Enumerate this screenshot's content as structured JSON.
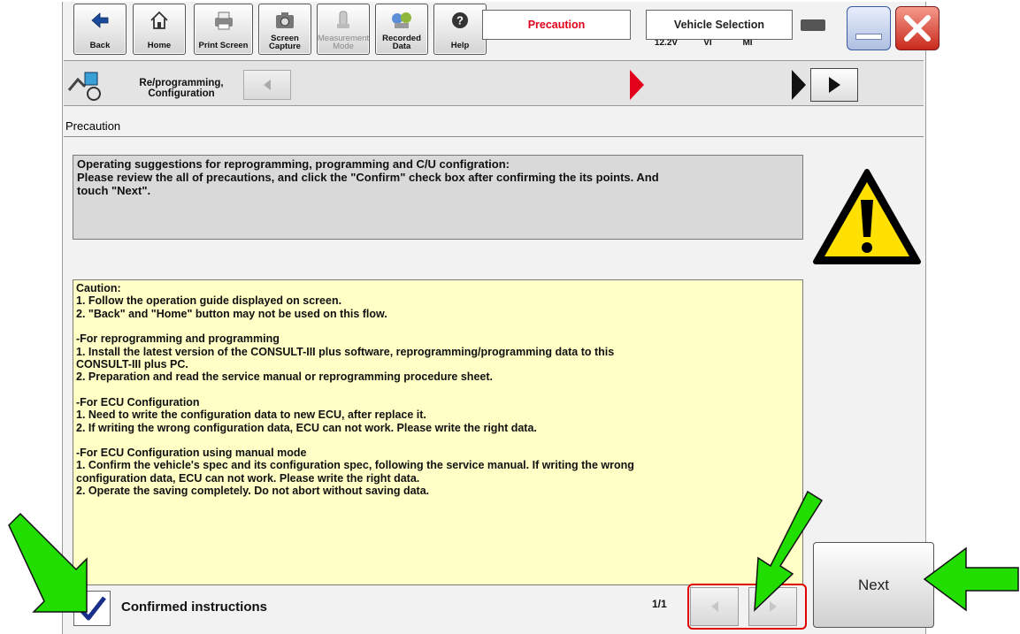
{
  "toolbar": {
    "back": "Back",
    "home": "Home",
    "print_screen": "Print Screen",
    "screen_capture": "Screen\nCapture",
    "measurement_mode": "Measurement\nMode",
    "recorded_data": "Recorded\nData",
    "help": "Help"
  },
  "status": {
    "battery_voltage": "12.2V",
    "vi": "VI",
    "mi": "MI"
  },
  "breadcrumb": {
    "module": "Re/programming,\nConfiguration",
    "step_current": "Precaution",
    "step_next": "Vehicle Selection"
  },
  "section_title": "Precaution",
  "message": {
    "line1": "Operating suggestions for reprogramming, programming and C/U configration:",
    "line2": "Please review the all of precautions, and click the \"Confirm\" check box after confirming the its points. And",
    "line3": "touch \"Next\"."
  },
  "caution": {
    "lines": [
      "Caution:",
      "1. Follow the operation guide displayed on screen.",
      "2. \"Back\"  and  \"Home\" button may not be used on this flow.",
      "",
      "-For reprogramming and programming",
      "1. Install the latest version of the CONSULT-III plus software, reprogramming/programming data to this",
      "CONSULT-III plus PC.",
      "2. Preparation and read the service manual or reprogramming procedure sheet.",
      "",
      "-For ECU Configuration",
      "1. Need to write the configuration data to new ECU, after replace it.",
      "2. If writing the wrong configuration data, ECU can not work. Please write the right data.",
      "",
      "-For ECU Configuration using manual mode",
      "1. Confirm the vehicle's spec and its configuration spec, following the service manual.  If writing the wrong",
      "configuration data, ECU can not work. Please write the right data.",
      "2. Operate the saving completely. Do not abort without saving data."
    ]
  },
  "confirm_label": "Confirmed instructions",
  "confirm_checked": true,
  "page_indicator": "1/1",
  "next_label": "Next",
  "colors": {
    "accent_red": "#e2001a",
    "caution_bg": "#ffffc6",
    "message_bg": "#d9d9d9",
    "arrow_green": "#22dd00",
    "check_blue": "#1a2f8a"
  }
}
